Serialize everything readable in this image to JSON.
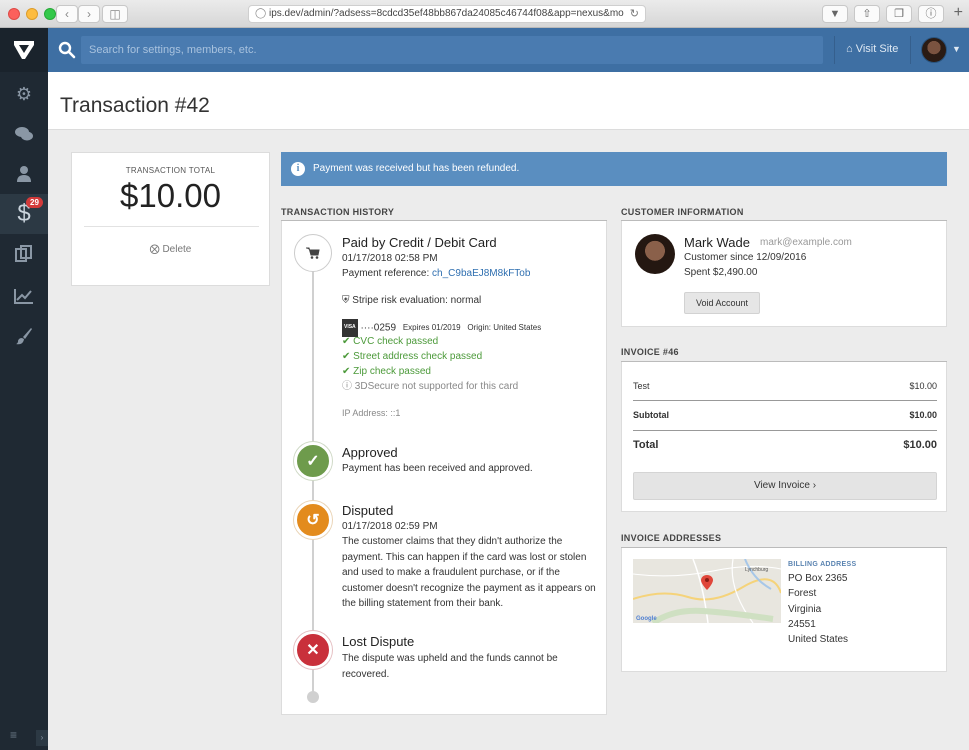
{
  "browser": {
    "url": "ips.dev/admin/?adsess=8cdcd35ef48bb867da24085c46744f08&app=nexus&mo"
  },
  "sidebar": {
    "badge_count": "29",
    "items": [
      "gears-icon",
      "comments-icon",
      "user-icon",
      "dollar-icon",
      "copy-icon",
      "chart-icon",
      "brush-icon"
    ]
  },
  "header": {
    "search_placeholder": "Search for settings, members, etc.",
    "visit_site": "Visit Site"
  },
  "page": {
    "title": "Transaction #42"
  },
  "total": {
    "label": "TRANSACTION TOTAL",
    "value": "$10.00",
    "delete": "Delete"
  },
  "alert": {
    "text": "Payment was received but has been refunded."
  },
  "history": {
    "label": "TRANSACTION HISTORY",
    "paid": {
      "title": "Paid by Credit / Debit Card",
      "date": "01/17/2018 02:58 PM",
      "ref_label": "Payment reference: ",
      "ref_value": "ch_C9baEJ8M8kFTob",
      "risk": "Stripe risk evaluation: normal",
      "card_brand": "VISA",
      "card_last4": "····0259",
      "card_expires": "Expires 01/2019",
      "card_origin": "Origin: United States",
      "cvc": "CVC check passed",
      "street": "Street address check passed",
      "zip": "Zip check passed",
      "threeds": "3DSecure not supported for this card",
      "ip": "IP Address: ::1"
    },
    "approved": {
      "title": "Approved",
      "text": "Payment has been received and approved."
    },
    "disputed": {
      "title": "Disputed",
      "date": "01/17/2018 02:59 PM",
      "text": "The customer claims that they didn't authorize the payment. This can happen if the card was lost or stolen and used to make a fraudulent purchase, or if the customer doesn't recognize the payment as it appears on the billing statement from their bank."
    },
    "lost": {
      "title": "Lost Dispute",
      "text": "The dispute was upheld and the funds cannot be recovered."
    }
  },
  "customer": {
    "label": "CUSTOMER INFORMATION",
    "name": "Mark Wade",
    "email": "mark@example.com",
    "since": "Customer since 12/09/2016",
    "spent": "Spent $2,490.00",
    "void_button": "Void Account"
  },
  "invoice": {
    "label": "INVOICE #46",
    "item_name": "Test",
    "item_value": "$10.00",
    "subtotal_label": "Subtotal",
    "subtotal_value": "$10.00",
    "total_label": "Total",
    "total_value": "$10.00",
    "view_button": "View Invoice ›"
  },
  "addresses": {
    "label": "INVOICE ADDRESSES",
    "billing_label": "BILLING ADDRESS",
    "line1": "PO Box 2365",
    "line2": "Forest",
    "line3": "Virginia",
    "line4": "24551",
    "line5": "United States",
    "map_city": "Lynchburg",
    "map_brand": "Google"
  },
  "colors": {
    "sidebar": "#1f2933",
    "topbar": "#3e6fa3",
    "alert": "#5a8ec0",
    "approved": "#6e9b4c",
    "disputed": "#e38b1d",
    "lost": "#c9303b"
  }
}
